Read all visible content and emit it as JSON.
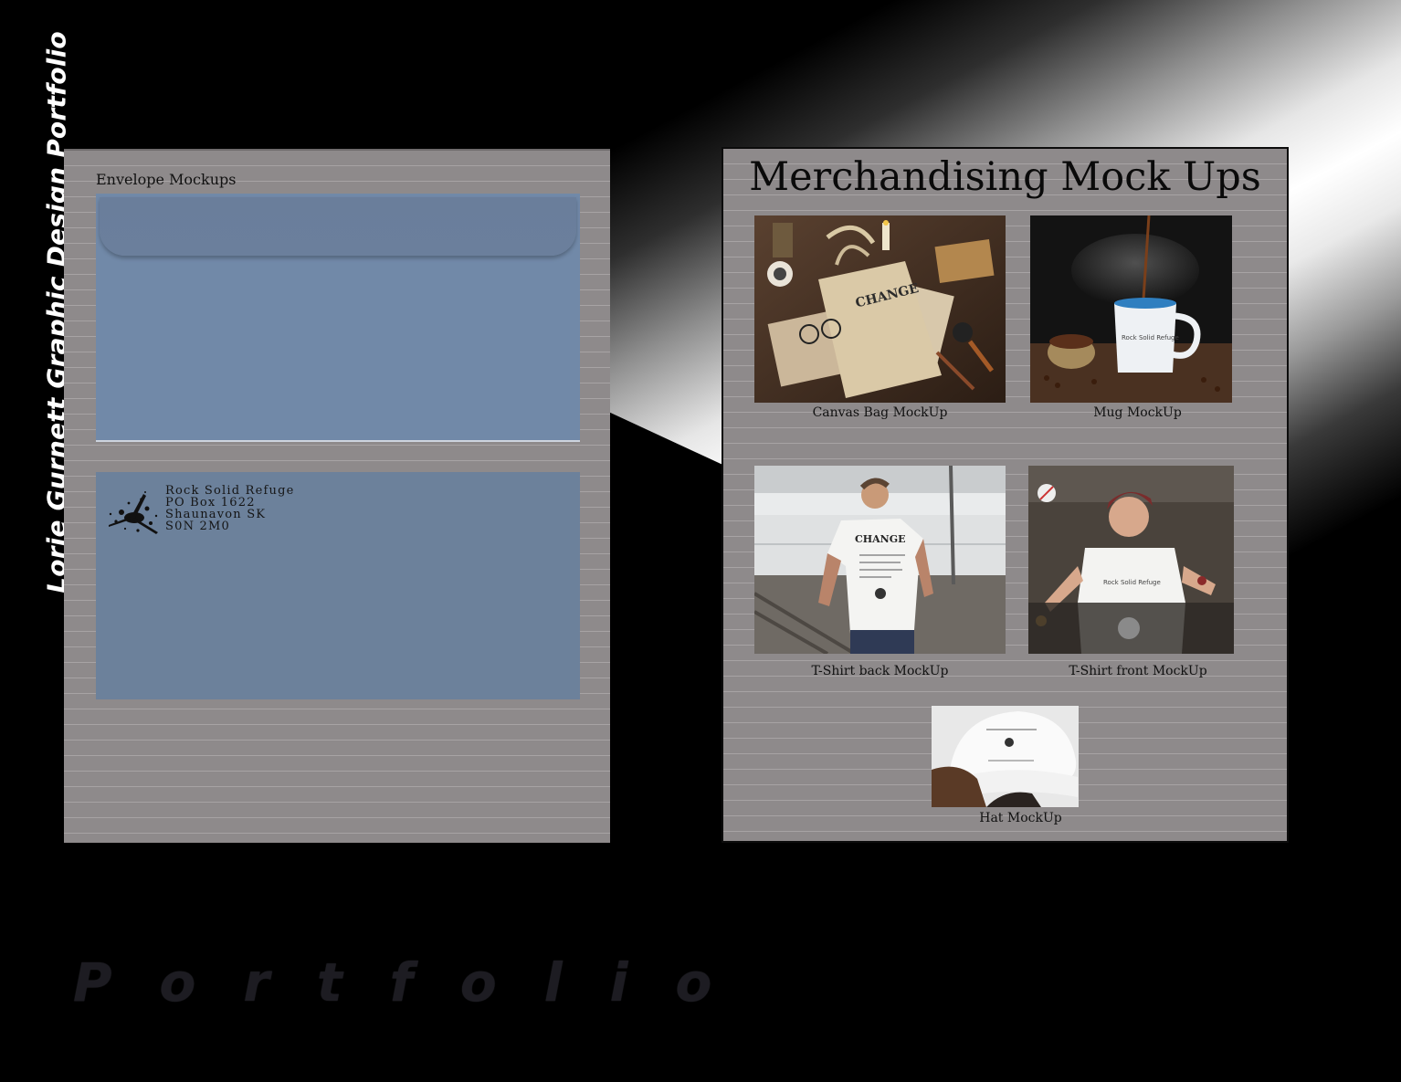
{
  "side_title": "Lorie Gurnett Graphic Design Portfolio",
  "left_page": {
    "heading": "Envelope Mockups",
    "address_lines": [
      "Rock Solid Refuge",
      "PO Box 1622",
      "Shaunavon SK",
      "S0N 2M0"
    ]
  },
  "right_page": {
    "heading": "Merchandising Mock Ups",
    "captions": {
      "canvas_bag": "Canvas Bag MockUp",
      "mug": "Mug MockUp",
      "tshirt_back": "T-Shirt back MockUp",
      "tshirt_front": "T-Shirt front MockUp",
      "hat": "Hat MockUp"
    },
    "bag_print": "CHANGE",
    "shirt_print": "CHANGE"
  },
  "footer_word": "Portfolio",
  "colors": {
    "page_gray": "#8e8a8b",
    "envelope_blue": "#7189a8",
    "background": "#000000"
  }
}
